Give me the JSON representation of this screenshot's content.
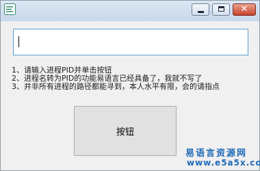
{
  "window": {
    "controls": {
      "close_glyph": "✕"
    }
  },
  "main": {
    "input": {
      "value": "",
      "placeholder": ""
    },
    "instructions": [
      "1、请输入进程PID并单击按钮",
      "2、进程名转为PID的功能易语言已经具备了，我就不写了",
      "3、并非所有进程的路径都能寻到，本人水平有限，会的请指点"
    ],
    "button_label": "按钮"
  },
  "watermark": {
    "name": "易语言资源网",
    "url": "www.e5a5x.com"
  },
  "icons": {
    "app": "app-icon",
    "minimize": "minimize-icon",
    "maximize": "maximize-icon",
    "close": "close-icon"
  },
  "colors": {
    "titlebar": "#c9d8ea",
    "close_button": "#c9402c",
    "input_border": "#5ba0cf",
    "button_face": "#e1e1e1",
    "watermark": "#1e6ab8"
  }
}
